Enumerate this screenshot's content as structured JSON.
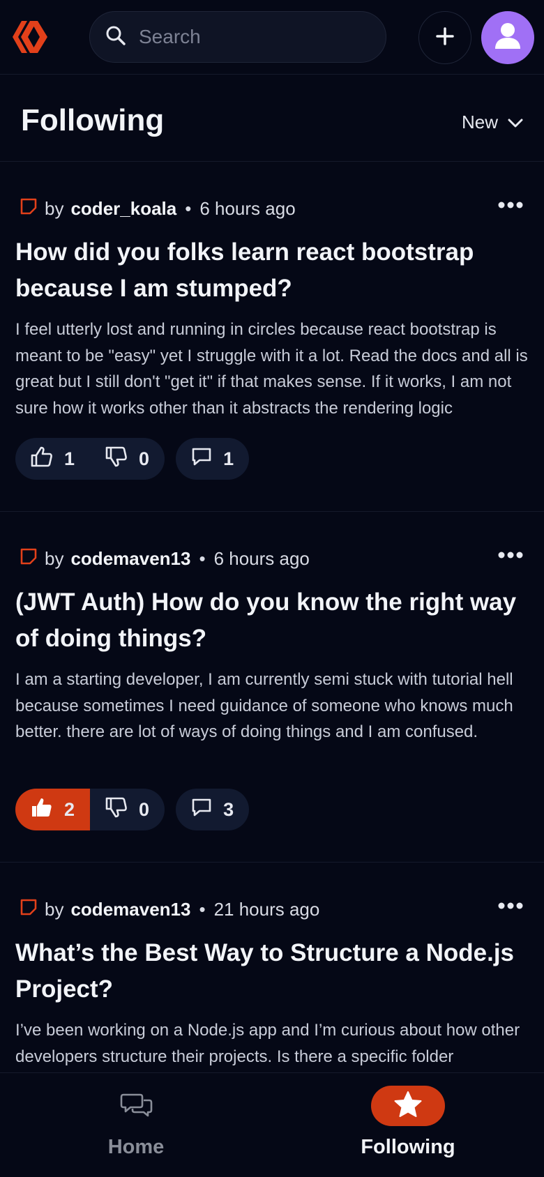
{
  "header": {
    "search_placeholder": "Search",
    "icons": [
      "hive-logo",
      "search-icon",
      "plus-icon",
      "user-icon"
    ]
  },
  "page": {
    "title": "Following",
    "sort_label": "New"
  },
  "posts": [
    {
      "by": "by",
      "author": "coder_koala",
      "time": "6 hours ago",
      "title": "How did you folks learn react bootstrap because I am stumped?",
      "excerpt": "I feel utterly lost and running in circles because react bootstrap is meant to be \"easy\" yet I struggle with it a lot. Read the docs and all is great but I still don't \"get it\" if that makes sense. If it works, I am not sure how it works other than it abstracts the rendering logic",
      "upvotes": "1",
      "downvotes": "0",
      "comments": "1",
      "upvoted": false
    },
    {
      "by": "by",
      "author": "codemaven13",
      "time": "6 hours ago",
      "title": "(JWT Auth) How do you know the right way of doing things?",
      "excerpt": "I am a starting developer, I am currently semi stuck with tutorial hell because sometimes I need guidance of someone who knows much better. there are lot of ways of doing things and I am confused.",
      "upvotes": "2",
      "downvotes": "0",
      "comments": "3",
      "upvoted": true
    },
    {
      "by": "by",
      "author": "codemaven13",
      "time": "21 hours ago",
      "title": "What’s the Best Way to Structure a Node.js Project?",
      "excerpt": "I’ve been working on a Node.js app and I’m curious about how other developers structure their projects. Is there a specific folder"
    }
  ],
  "bottom_nav": {
    "home_label": "Home",
    "following_label": "Following",
    "active": "following"
  },
  "colors": {
    "background": "#050816",
    "accent": "#cf3912",
    "avatar": "#a070f5",
    "pill": "#121a30"
  }
}
